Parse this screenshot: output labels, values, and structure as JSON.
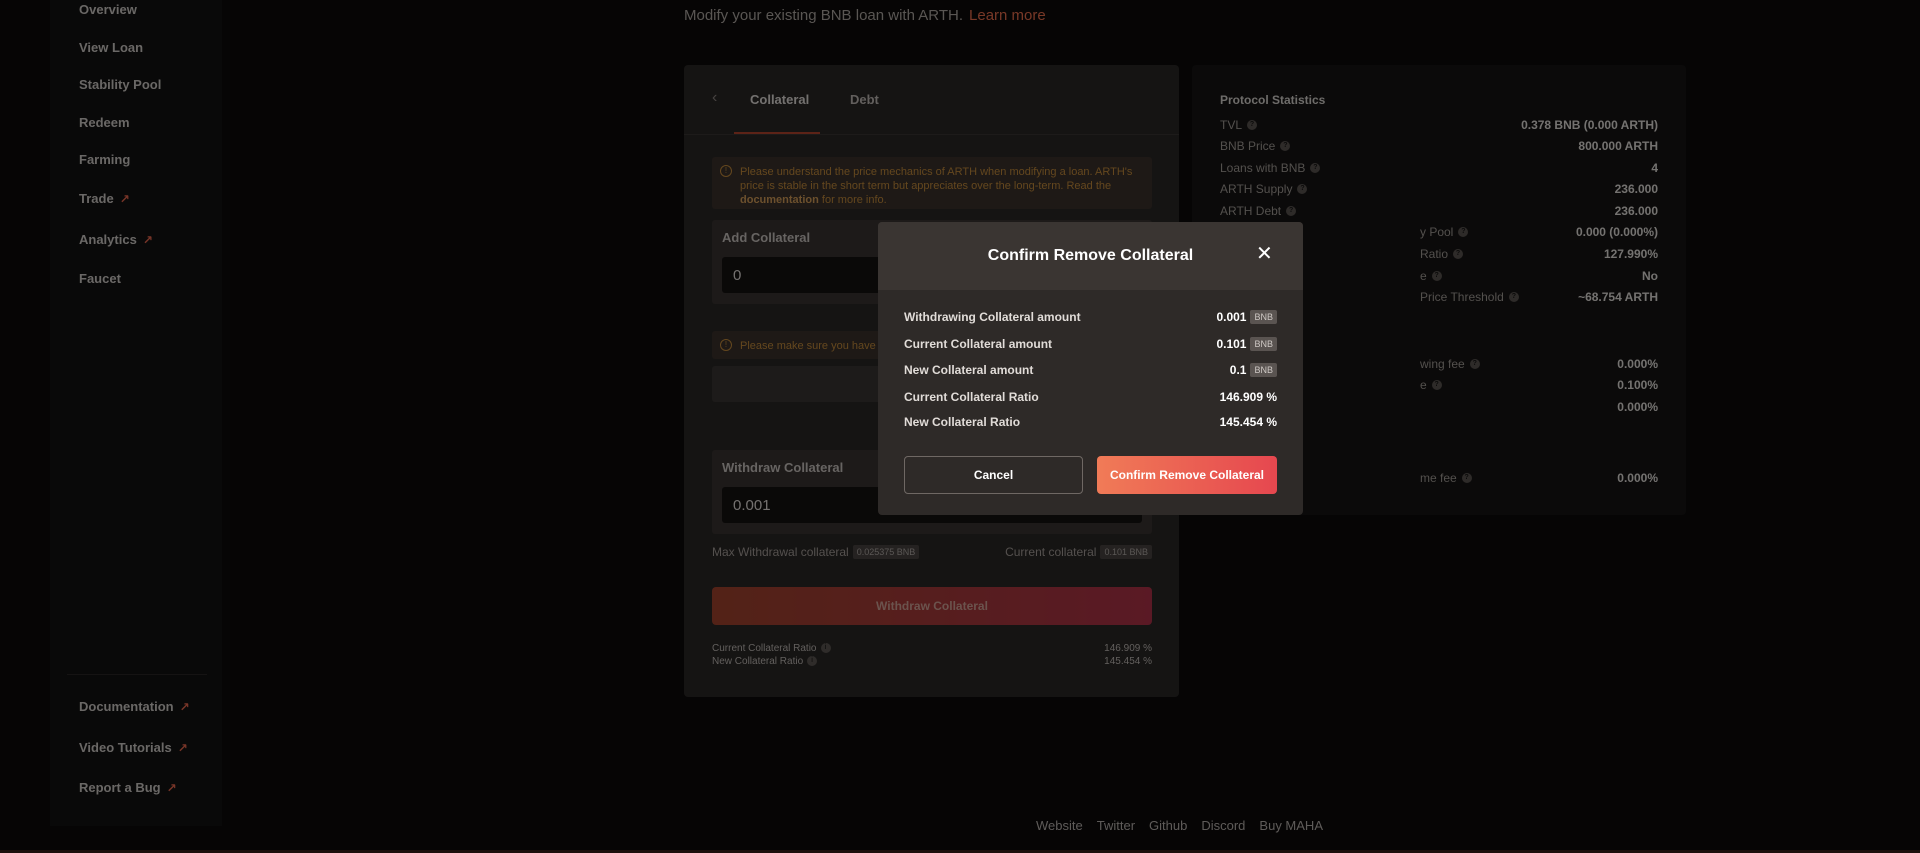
{
  "sidebar": {
    "items": [
      {
        "label": "Overview"
      },
      {
        "label": "View Loan"
      },
      {
        "label": "Stability Pool"
      },
      {
        "label": "Redeem"
      },
      {
        "label": "Farming"
      },
      {
        "label": "Trade",
        "external": true
      },
      {
        "label": "Analytics",
        "external": true
      },
      {
        "label": "Faucet"
      }
    ],
    "bottom_items": [
      {
        "label": "Documentation",
        "external": true
      },
      {
        "label": "Video Tutorials",
        "external": true
      },
      {
        "label": "Report a Bug",
        "external": true
      }
    ],
    "external_icon": "↗"
  },
  "header": {
    "subtitle": "Modify your existing BNB loan with ARTH.",
    "learn_more": "Learn more"
  },
  "card": {
    "back_icon": "‹",
    "tabs": [
      {
        "label": "Collateral",
        "active": true
      },
      {
        "label": "Debt",
        "active": false
      }
    ],
    "warning": {
      "icon": "!",
      "text_before": "Please understand the price mechanics of ARTH when modifying a loan. ARTH's price is stable in the short term but appreciates over the long-term. Read the ",
      "link": "documentation",
      "text_after": " for more info."
    },
    "add_collateral": {
      "label": "Add Collateral",
      "value": "0"
    },
    "approve_warning": "Please make sure you have g",
    "withdraw_collateral": {
      "label": "Withdraw Collateral",
      "value": "0.001"
    },
    "max_withdrawal_label": "Max Withdrawal collateral",
    "max_withdrawal_value": "0.025375 BNB",
    "current_collateral_label": "Current collateral",
    "current_collateral_value": "0.101 BNB",
    "withdraw_button": "Withdraw Collateral",
    "current_ratio_label": "Current Collateral Ratio",
    "current_ratio_value": "146.909 %",
    "new_ratio_label": "New Collateral Ratio",
    "new_ratio_value": "145.454 %"
  },
  "stats": {
    "title": "Protocol Statistics",
    "rows": [
      {
        "label": "TVL",
        "value": "0.378 BNB (0.000 ARTH)"
      },
      {
        "label": "BNB Price",
        "value": "800.000 ARTH"
      },
      {
        "label": "Loans with BNB",
        "value": "4"
      },
      {
        "label": "ARTH Supply",
        "value": "236.000"
      },
      {
        "label": "ARTH Debt",
        "value": "236.000"
      },
      {
        "label": "y Pool",
        "value": "0.000 (0.000%)"
      },
      {
        "label": "Ratio",
        "value": "127.990%"
      },
      {
        "label": "e",
        "value": "No"
      },
      {
        "label": "Price Threshold",
        "value": "~68.754 ARTH"
      },
      {
        "label": "wing fee",
        "value": "0.000%"
      },
      {
        "label": "e",
        "value": "0.100%"
      },
      {
        "label": "",
        "value": "0.000%"
      },
      {
        "label": "me fee",
        "value": "0.000%"
      }
    ]
  },
  "footer": {
    "links": [
      "Website",
      "Twitter",
      "Github",
      "Discord",
      "Buy MAHA"
    ]
  },
  "modal": {
    "title": "Confirm Remove Collateral",
    "close_icon": "✕",
    "rows": [
      {
        "label": "Withdrawing Collateral amount",
        "value": "0.001",
        "unit": "BNB"
      },
      {
        "label": "Current Collateral amount",
        "value": "0.101",
        "unit": "BNB"
      },
      {
        "label": "New Collateral amount",
        "value": "0.1",
        "unit": "BNB"
      },
      {
        "label": "Current Collateral Ratio",
        "value": "146.909 %"
      },
      {
        "label": "New Collateral Ratio",
        "value": "145.454 %"
      }
    ],
    "cancel_button": "Cancel",
    "confirm_button": "Confirm Remove Collateral"
  },
  "colors": {
    "accent": "#f0714f",
    "warning": "#c98e3c",
    "background": "#0c0b0b"
  }
}
